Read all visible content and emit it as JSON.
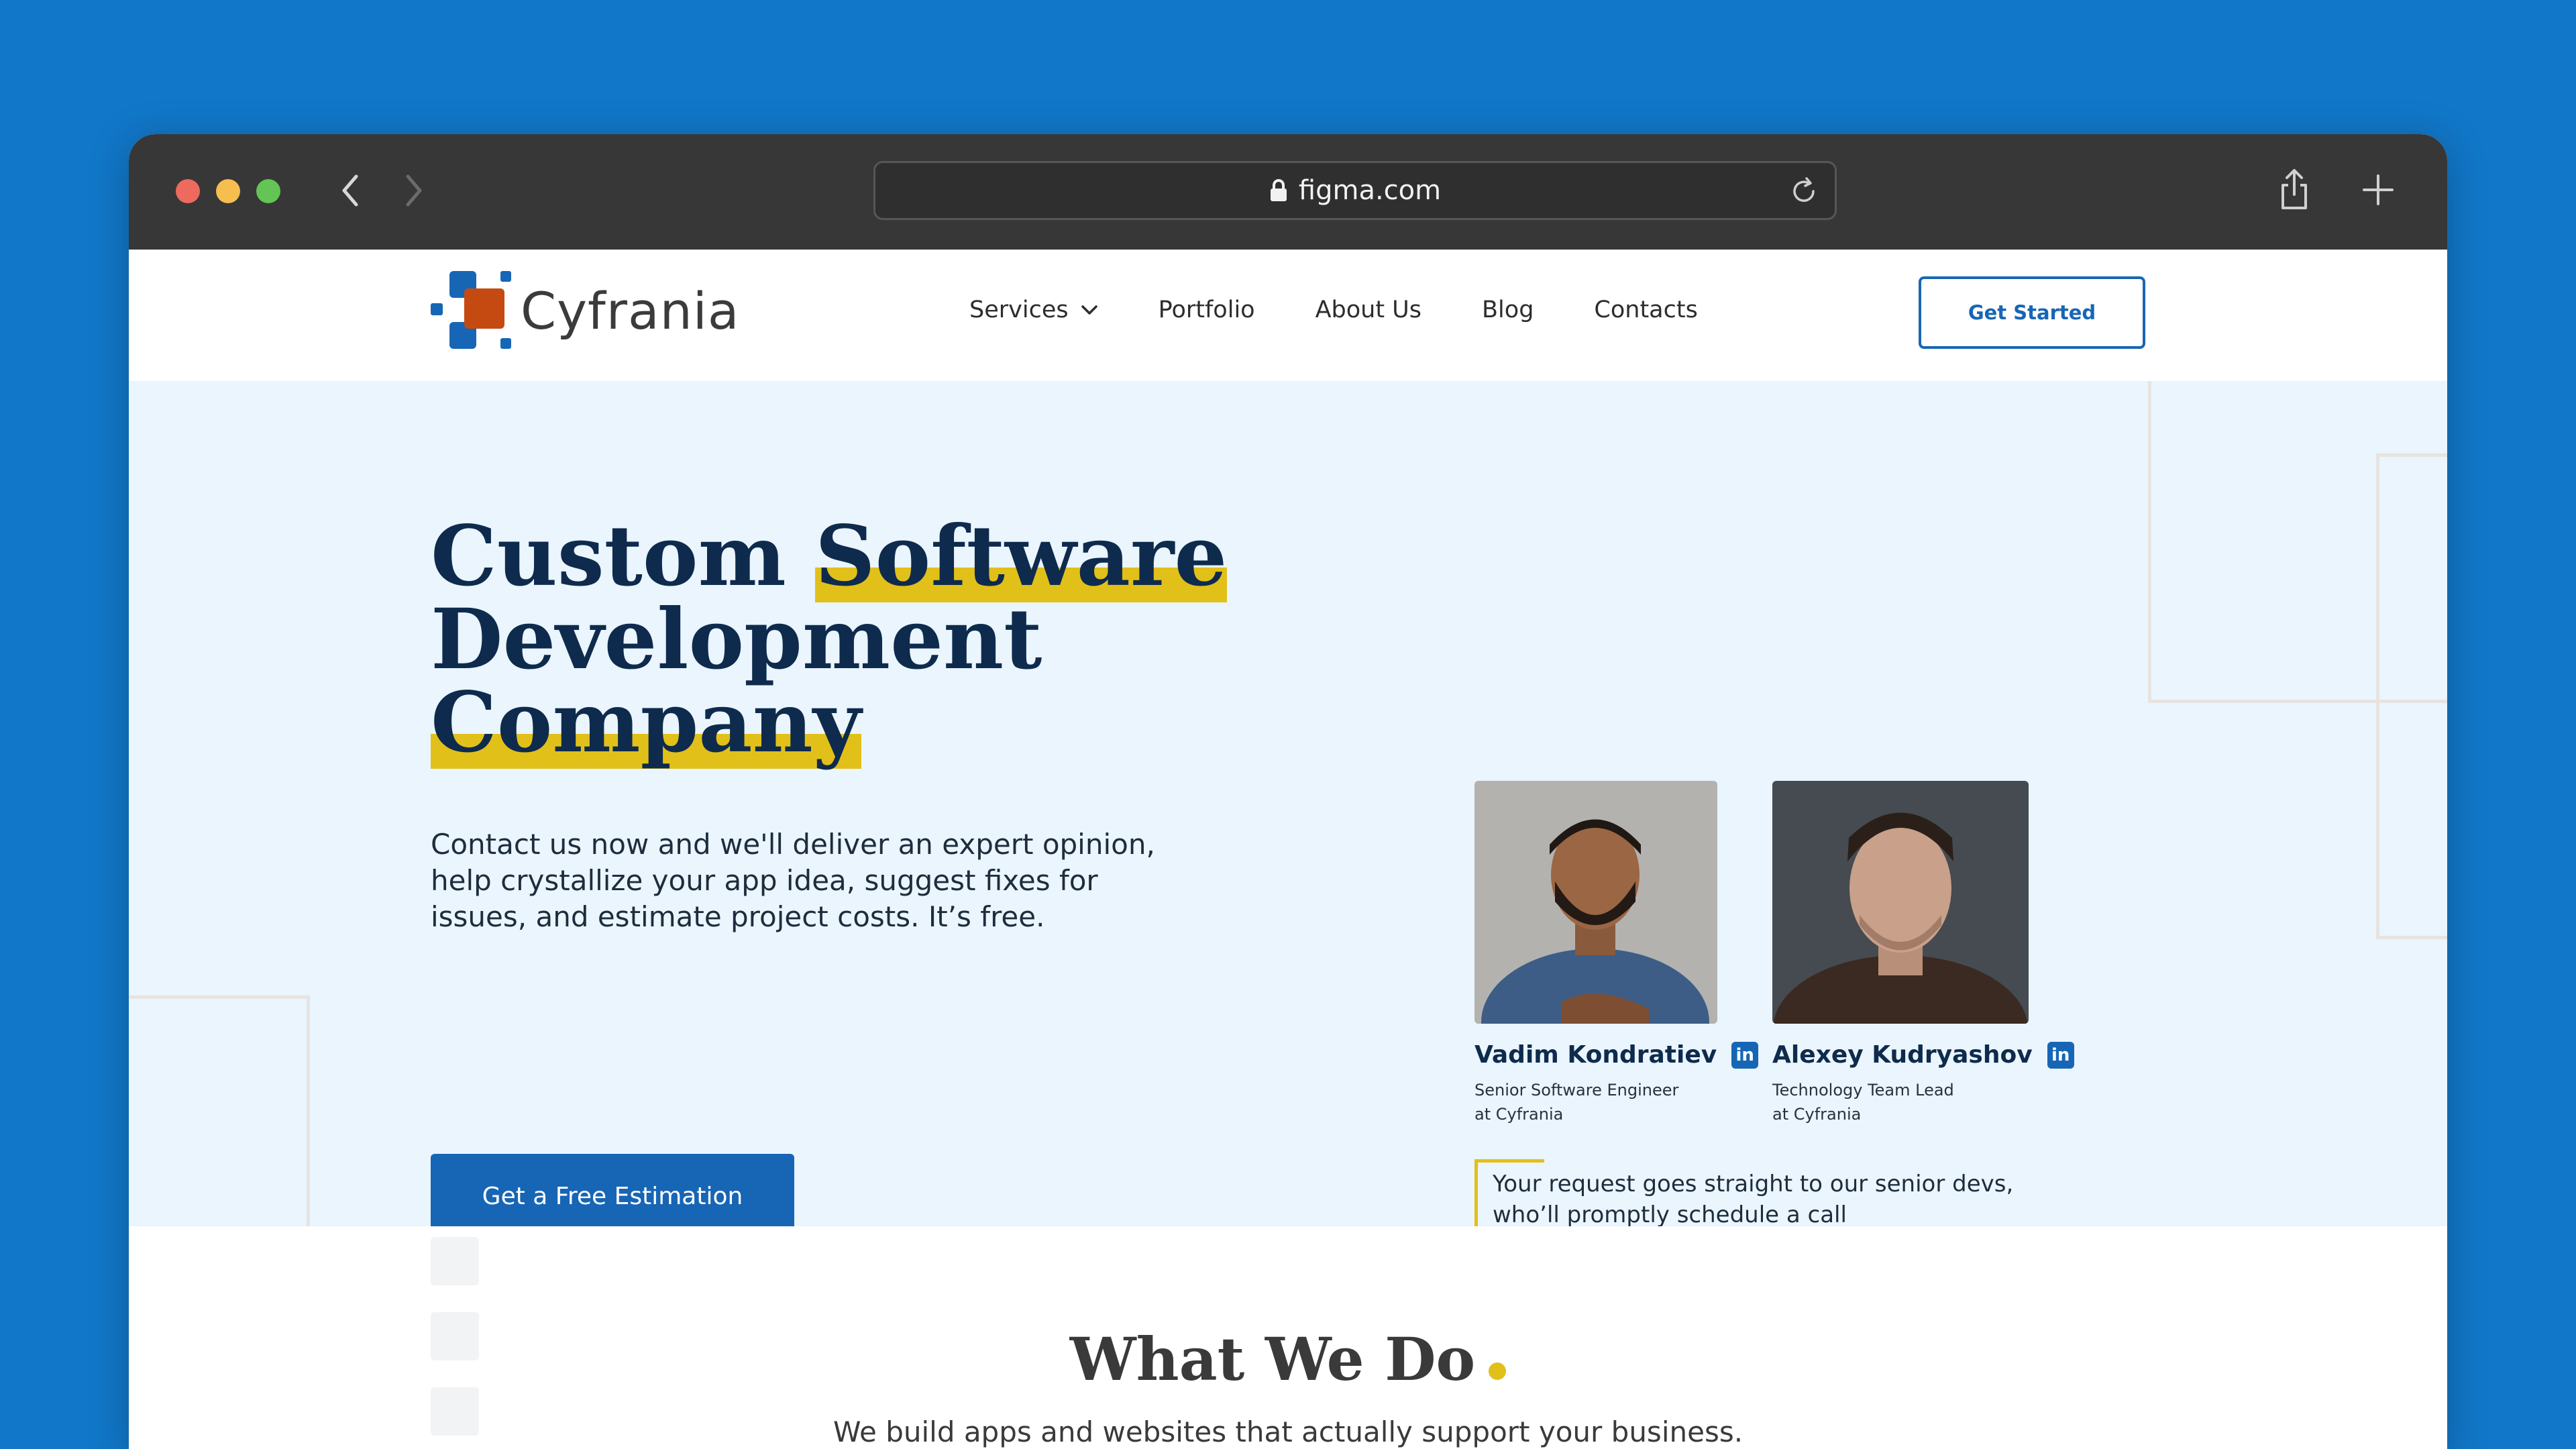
{
  "browser": {
    "url": "figma.com"
  },
  "header": {
    "logo_text": "Cyfrania",
    "menu": [
      "Services",
      "Portfolio",
      "About Us",
      "Blog",
      "Contacts"
    ],
    "cta": "Get Started"
  },
  "hero": {
    "headline_1a": "Custom",
    "headline_1b": "Software",
    "headline_2": "Development",
    "headline_3": "Company",
    "description": "Contact us now and we'll deliver an expert opinion, help crystallize your app idea, suggest fixes for issues, and estimate project costs. It’s free.",
    "cta": "Get a Free Estimation"
  },
  "team": [
    {
      "name": "Vadim Kondratiev",
      "role_1": "Senior Software Engineer",
      "role_2": "at Cyfrania"
    },
    {
      "name": "Alexey Kudryashov",
      "role_1": "Technology Team Lead",
      "role_2": "at Cyfrania"
    }
  ],
  "linkedin_badge": "in",
  "quote": {
    "line_1": "Your request goes straight to our senior devs,",
    "line_2": "who’ll promptly schedule a call"
  },
  "what_we_do": {
    "title": "What We Do",
    "subtitle": "We build apps and websites that actually support your business."
  },
  "colors": {
    "background": "#1177c8",
    "chrome": "#373737",
    "brand_blue": "#1766b5",
    "brand_orange": "#c54a12",
    "navy": "#0e2b4d",
    "highlight": "#e2c01a",
    "hero_bg": "#eaf5fd"
  },
  "icons": [
    "lock-icon",
    "reload-icon",
    "share-icon",
    "plus-icon",
    "chevron-left-icon",
    "chevron-right-icon",
    "chevron-down-icon",
    "linkedin-icon"
  ]
}
